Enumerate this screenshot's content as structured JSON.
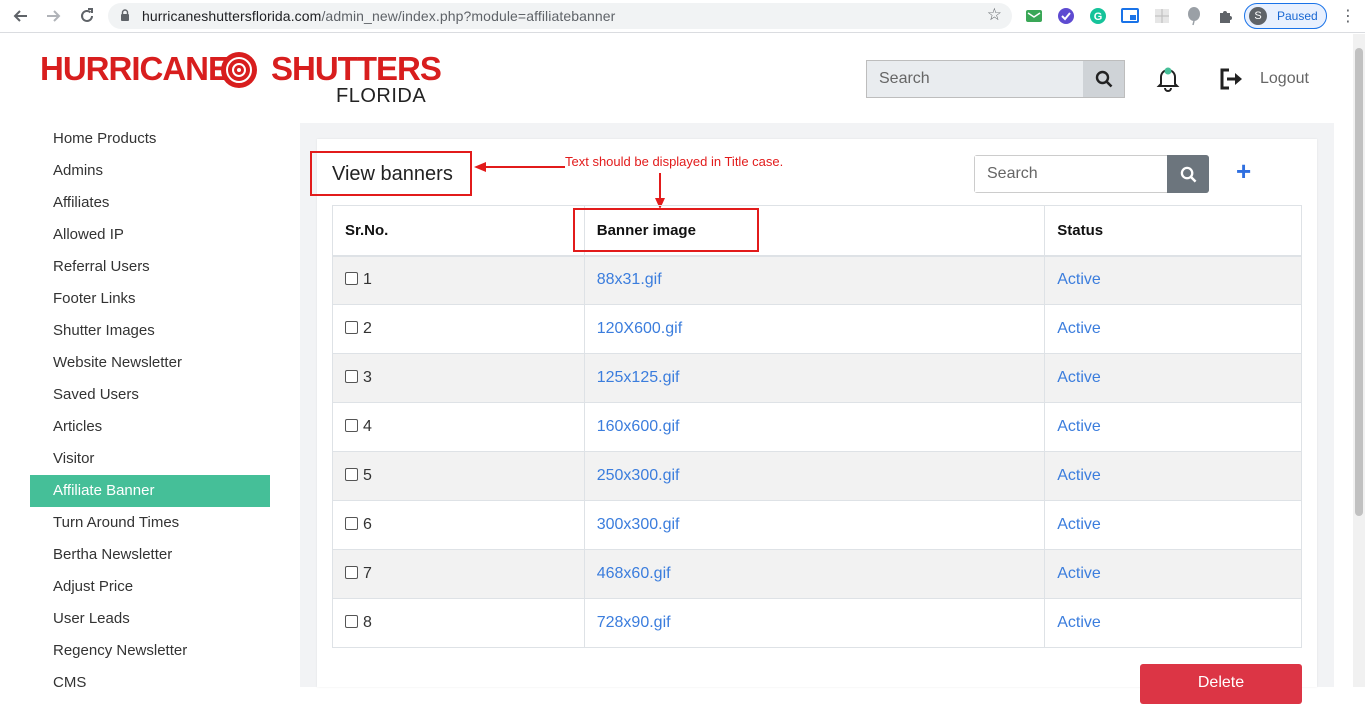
{
  "browser": {
    "url_host": "hurricaneshuttersflorida.com",
    "url_path": "/admin_new/index.php?module=affiliatebanner",
    "profile_initial": "S",
    "profile_status": "Paused"
  },
  "header": {
    "logo_left": "HURRICANE",
    "logo_right": "SHUTTERS",
    "logo_sub": "FLORIDA",
    "search_placeholder": "Search",
    "logout_label": "Logout"
  },
  "sidebar": {
    "items": [
      {
        "label": "Home Products"
      },
      {
        "label": "Admins"
      },
      {
        "label": "Affiliates"
      },
      {
        "label": "Allowed IP"
      },
      {
        "label": "Referral Users"
      },
      {
        "label": "Footer Links"
      },
      {
        "label": "Shutter Images"
      },
      {
        "label": "Website Newsletter"
      },
      {
        "label": "Saved Users"
      },
      {
        "label": "Articles"
      },
      {
        "label": "Visitor"
      },
      {
        "label": "Affiliate Banner"
      },
      {
        "label": "Turn Around Times"
      },
      {
        "label": "Bertha Newsletter"
      },
      {
        "label": "Adjust Price"
      },
      {
        "label": "User Leads"
      },
      {
        "label": "Regency Newsletter"
      },
      {
        "label": "CMS"
      }
    ]
  },
  "main": {
    "title": "View banners",
    "annotation": "Text should be displayed in Title case.",
    "search_placeholder": "Search",
    "add_label": "+",
    "table": {
      "headers": [
        "Sr.No.",
        "Banner image",
        "Status"
      ],
      "rows": [
        {
          "no": "1",
          "image": "88x31.gif",
          "status": "Active"
        },
        {
          "no": "2",
          "image": "120X600.gif",
          "status": "Active"
        },
        {
          "no": "3",
          "image": "125x125.gif",
          "status": "Active"
        },
        {
          "no": "4",
          "image": "160x600.gif",
          "status": "Active"
        },
        {
          "no": "5",
          "image": "250x300.gif",
          "status": "Active"
        },
        {
          "no": "6",
          "image": "300x300.gif",
          "status": "Active"
        },
        {
          "no": "7",
          "image": "468x60.gif",
          "status": "Active"
        },
        {
          "no": "8",
          "image": "728x90.gif",
          "status": "Active"
        }
      ]
    },
    "delete_label": "Delete"
  },
  "colors": {
    "active_sidebar": "#45bf98",
    "link": "#3b7ddd",
    "annotation_red": "#e21b1b",
    "delete_red": "#dc3545"
  }
}
